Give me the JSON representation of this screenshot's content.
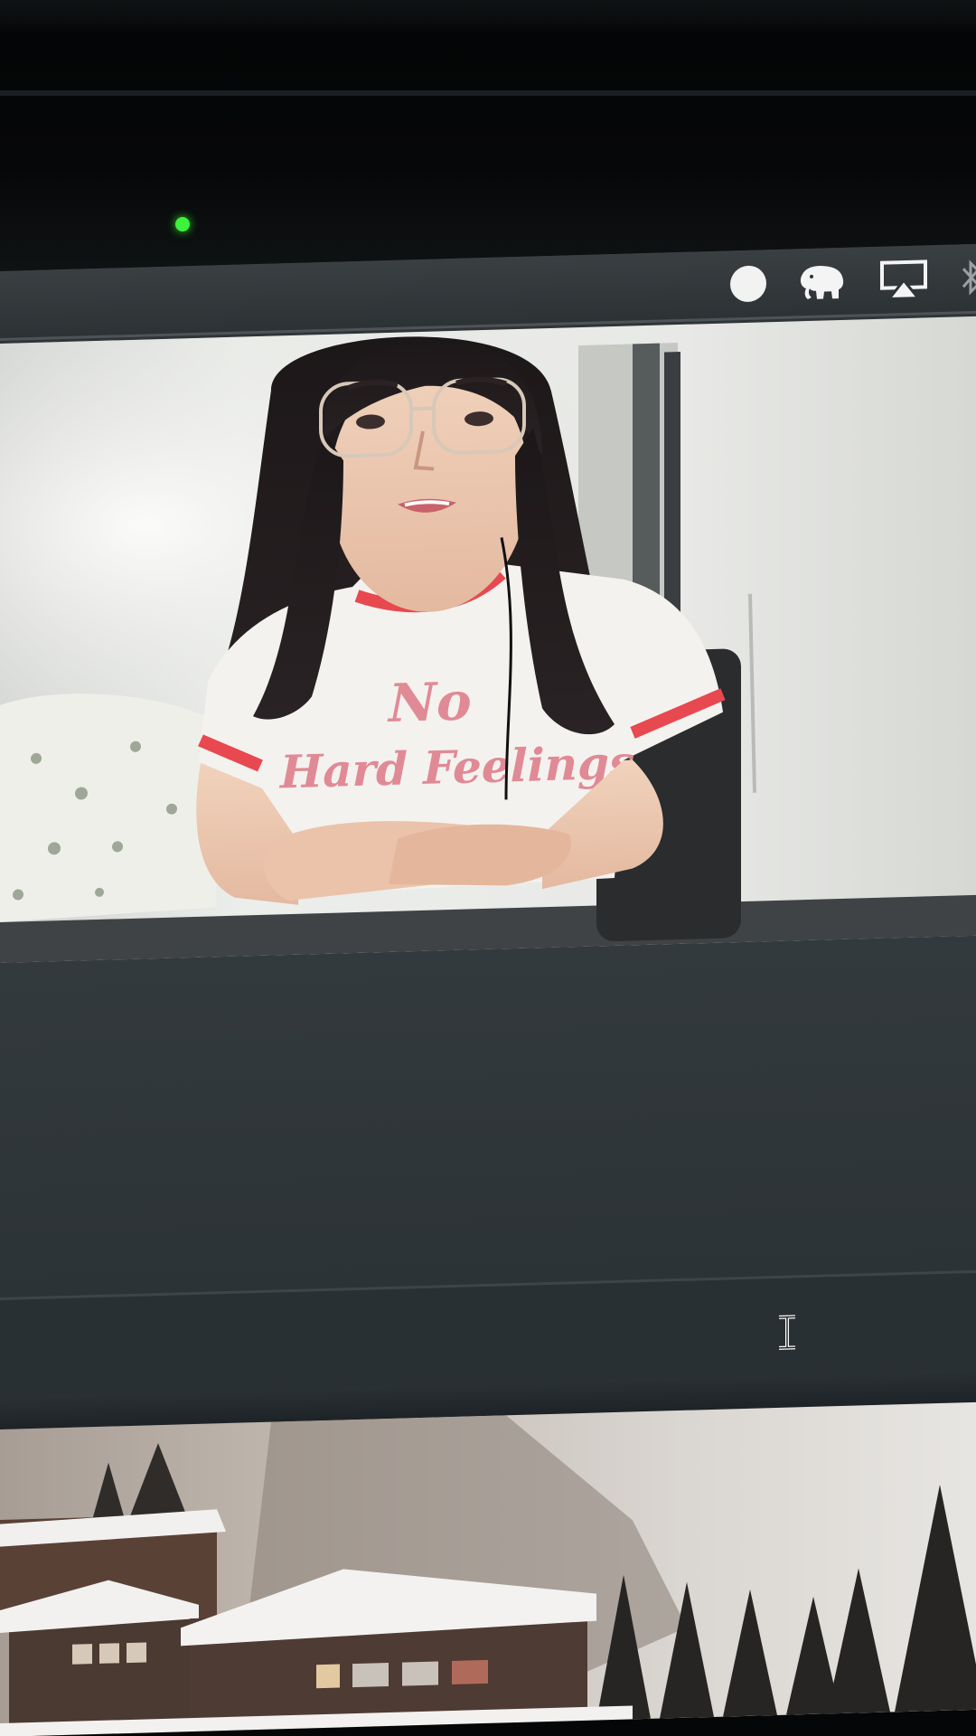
{
  "menubar": {
    "icons": [
      "status-dot-icon",
      "elephant-icon",
      "airplay-icon",
      "bluetooth-icon"
    ]
  },
  "camera": {
    "led_color": "#3df23a"
  },
  "video": {
    "shirt_text": "No Hard Feelings"
  },
  "colors": {
    "screen_bg": "#2f3437",
    "menubar_bg": "#3a3f42",
    "shirt_trim": "#e8484f",
    "shirt_print": "#e08a95"
  }
}
